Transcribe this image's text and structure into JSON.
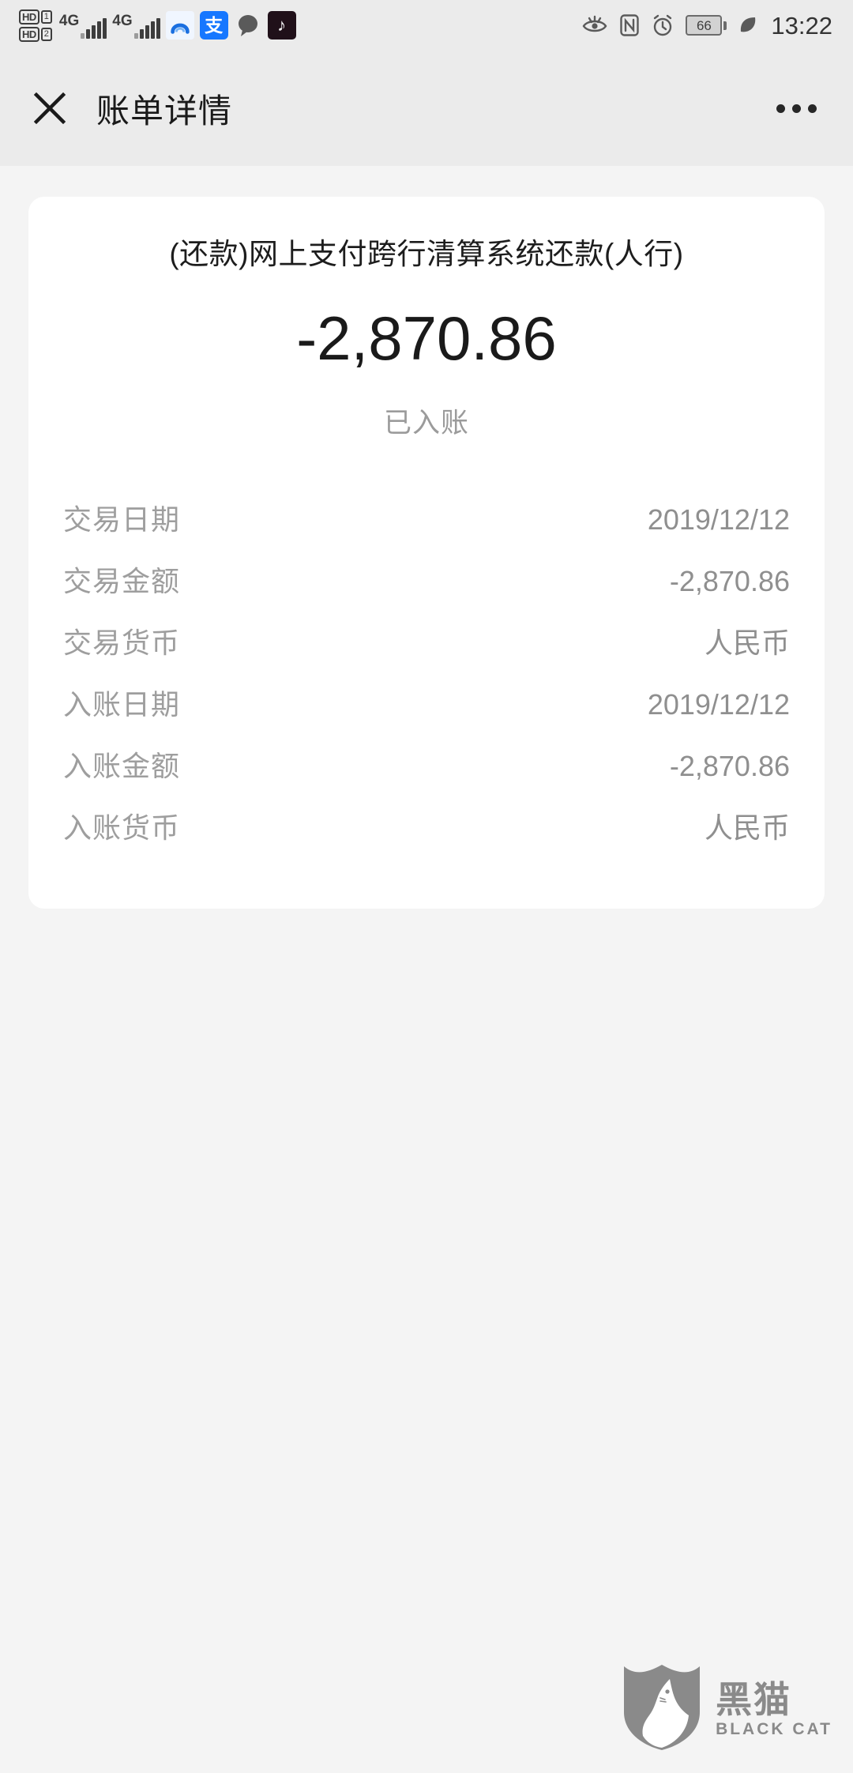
{
  "status_bar": {
    "hd_labels": [
      "HD",
      "HD"
    ],
    "sim_labels": [
      "1",
      "2"
    ],
    "networks": [
      "4G",
      "4G"
    ],
    "app_icons": [
      "browser-icon",
      "alipay-icon",
      "chat-bubble-icon",
      "tiktok-icon"
    ],
    "eye_comfort_icon": "eye-comfort-icon",
    "nfc_icon": "nfc-icon",
    "alarm_icon": "alarm-clock-icon",
    "battery_level": "66",
    "power_saving_icon": "leaf-power-saving-icon",
    "time": "13:22"
  },
  "header": {
    "close_icon": "close-icon",
    "title": "账单详情",
    "more_icon": "more-options-icon"
  },
  "transaction": {
    "title": "(还款)网上支付跨行清算系统还款(人行)",
    "amount": "-2,870.86",
    "status": "已入账"
  },
  "details": {
    "rows": [
      {
        "label": "交易日期",
        "value": "2019/12/12"
      },
      {
        "label": "交易金额",
        "value": "-2,870.86"
      },
      {
        "label": "交易货币",
        "value": "人民币"
      },
      {
        "label": "入账日期",
        "value": "2019/12/12"
      },
      {
        "label": "入账金额",
        "value": "-2,870.86"
      },
      {
        "label": "入账货币",
        "value": "人民币"
      }
    ]
  },
  "watermark": {
    "logo_icon": "black-cat-shield-logo",
    "name_cn": "黑猫",
    "name_en": "BLACK CAT"
  }
}
